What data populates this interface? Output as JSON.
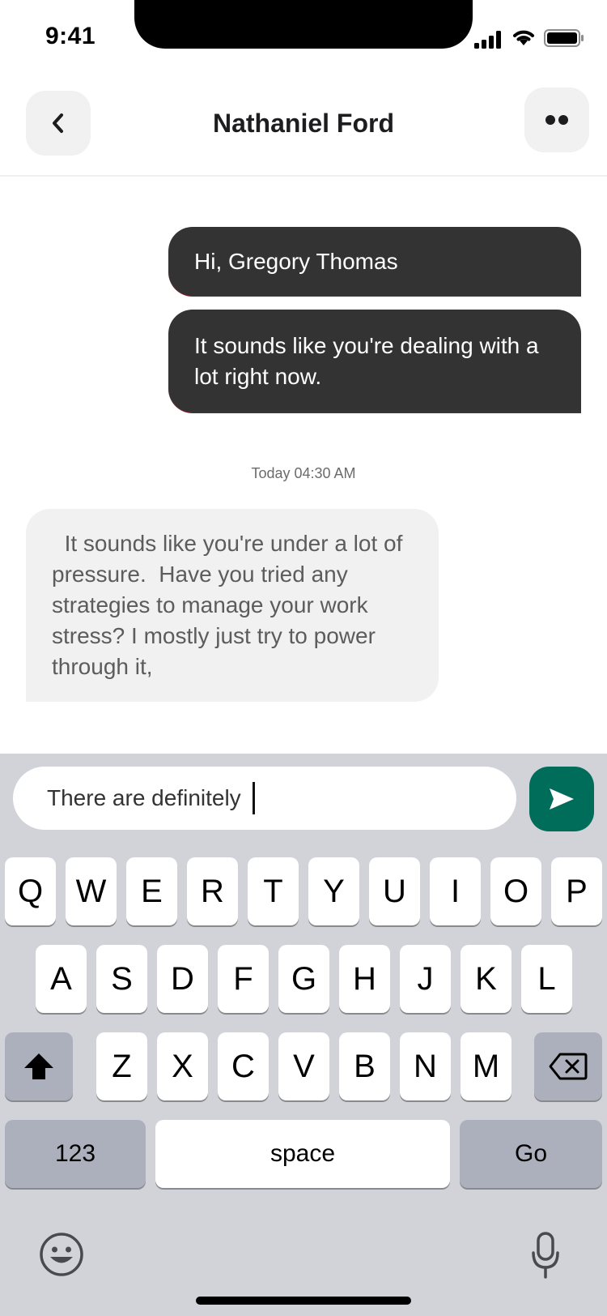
{
  "status_bar": {
    "time": "9:41"
  },
  "header": {
    "title": "Nathaniel Ford"
  },
  "messages": {
    "outgoing": [
      {
        "text": "Hi, Gregory Thomas"
      },
      {
        "text": "It sounds like you're dealing with a lot right now."
      }
    ],
    "timestamp": "Today 04:30 AM",
    "incoming": [
      {
        "text": "  It sounds like you're under a lot of pressure.  Have you tried any strategies to manage your work stress? I mostly just try to power through it,"
      }
    ]
  },
  "composer": {
    "value": "There are definitely"
  },
  "keyboard": {
    "row1": [
      "Q",
      "W",
      "E",
      "R",
      "T",
      "Y",
      "U",
      "I",
      "O",
      "P"
    ],
    "row2": [
      "A",
      "S",
      "D",
      "F",
      "G",
      "H",
      "J",
      "K",
      "L"
    ],
    "row3": [
      "Z",
      "X",
      "C",
      "V",
      "B",
      "N",
      "M"
    ],
    "numbers_label": "123",
    "space_label": "space",
    "go_label": "Go"
  },
  "colors": {
    "send_button": "#006d5b",
    "outgoing_bubble": "#333333",
    "incoming_bubble": "#f1f1f1",
    "keyboard_bg": "#d1d3d9"
  },
  "icons": {
    "back": "chevron-left-icon",
    "more": "more-dots-icon",
    "send": "send-icon",
    "shift": "shift-icon",
    "delete": "backspace-icon",
    "emoji": "emoji-icon",
    "mic": "microphone-icon"
  }
}
